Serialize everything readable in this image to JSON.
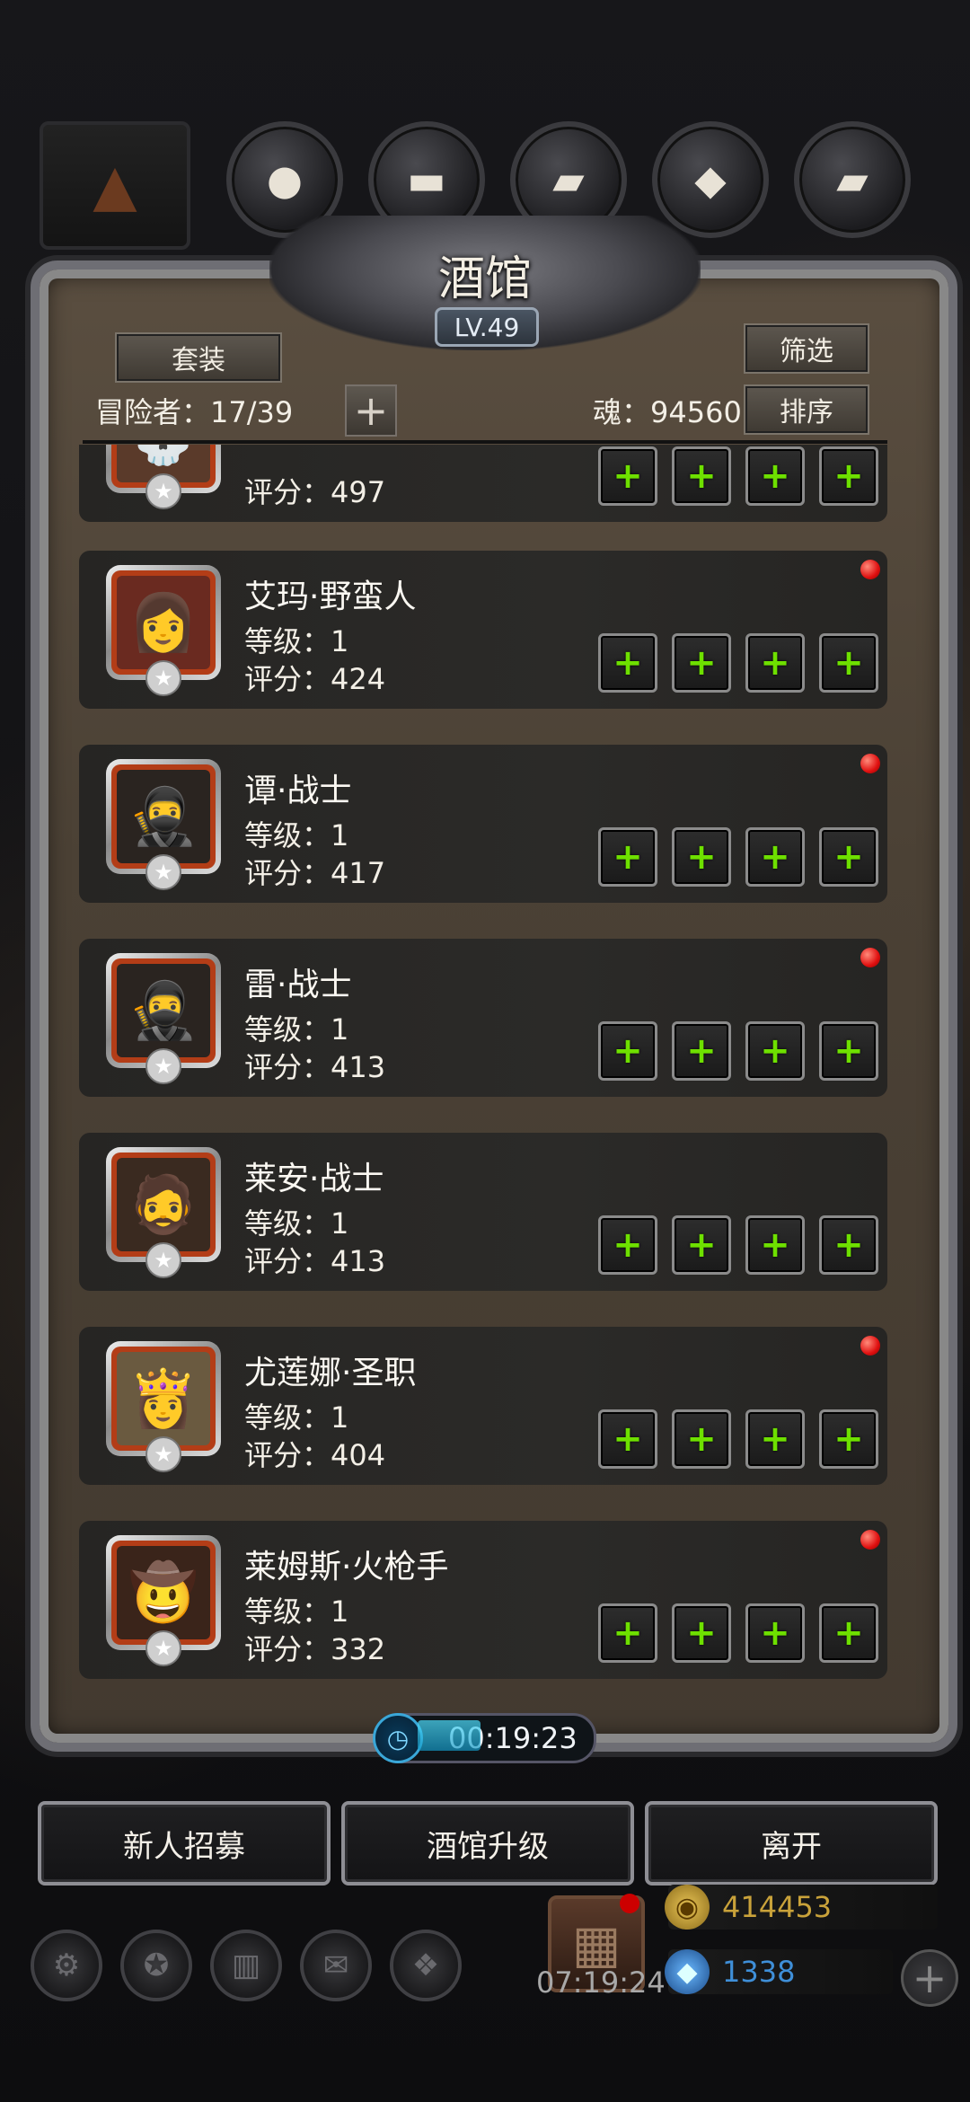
{
  "header": {
    "title": "酒馆",
    "level": "LV.49",
    "set_button": "套装",
    "filter_button": "筛选",
    "sort_button": "排序",
    "adventurers_label": "冒险者：",
    "adventurers_count": "17/39",
    "soul_label": "魂：",
    "soul_value": "94560",
    "add_symbol": "+"
  },
  "labels": {
    "level": "等级：",
    "score": "评分："
  },
  "partial_row": {
    "score": "497"
  },
  "heroes": [
    {
      "name": "艾玛·野蛮人",
      "level": "1",
      "score": "424",
      "has_dot": true,
      "face": "👩"
    },
    {
      "name": "谭·战士",
      "level": "1",
      "score": "417",
      "has_dot": true,
      "face": "🥷"
    },
    {
      "name": "雷·战士",
      "level": "1",
      "score": "413",
      "has_dot": true,
      "face": "🥷"
    },
    {
      "name": "莱安·战士",
      "level": "1",
      "score": "413",
      "has_dot": false,
      "face": "🧔"
    },
    {
      "name": "尤莲娜·圣职",
      "level": "1",
      "score": "404",
      "has_dot": true,
      "face": "👸"
    },
    {
      "name": "莱姆斯·火枪手",
      "level": "1",
      "score": "332",
      "has_dot": true,
      "face": "🤠"
    }
  ],
  "equip_plus": "+",
  "timer": {
    "value": "00:19:23"
  },
  "actions": {
    "recruit": "新人招募",
    "upgrade": "酒馆升级",
    "leave": "离开"
  },
  "footer": {
    "gift_timer": "07:19:24",
    "gold": "414453",
    "gems": "1338",
    "add_symbol": "+"
  },
  "colors": {
    "equip_plus": "#6ee000",
    "red_dot": "#e01010",
    "gold": "#c9a23a",
    "gems": "#3f8fd8"
  }
}
